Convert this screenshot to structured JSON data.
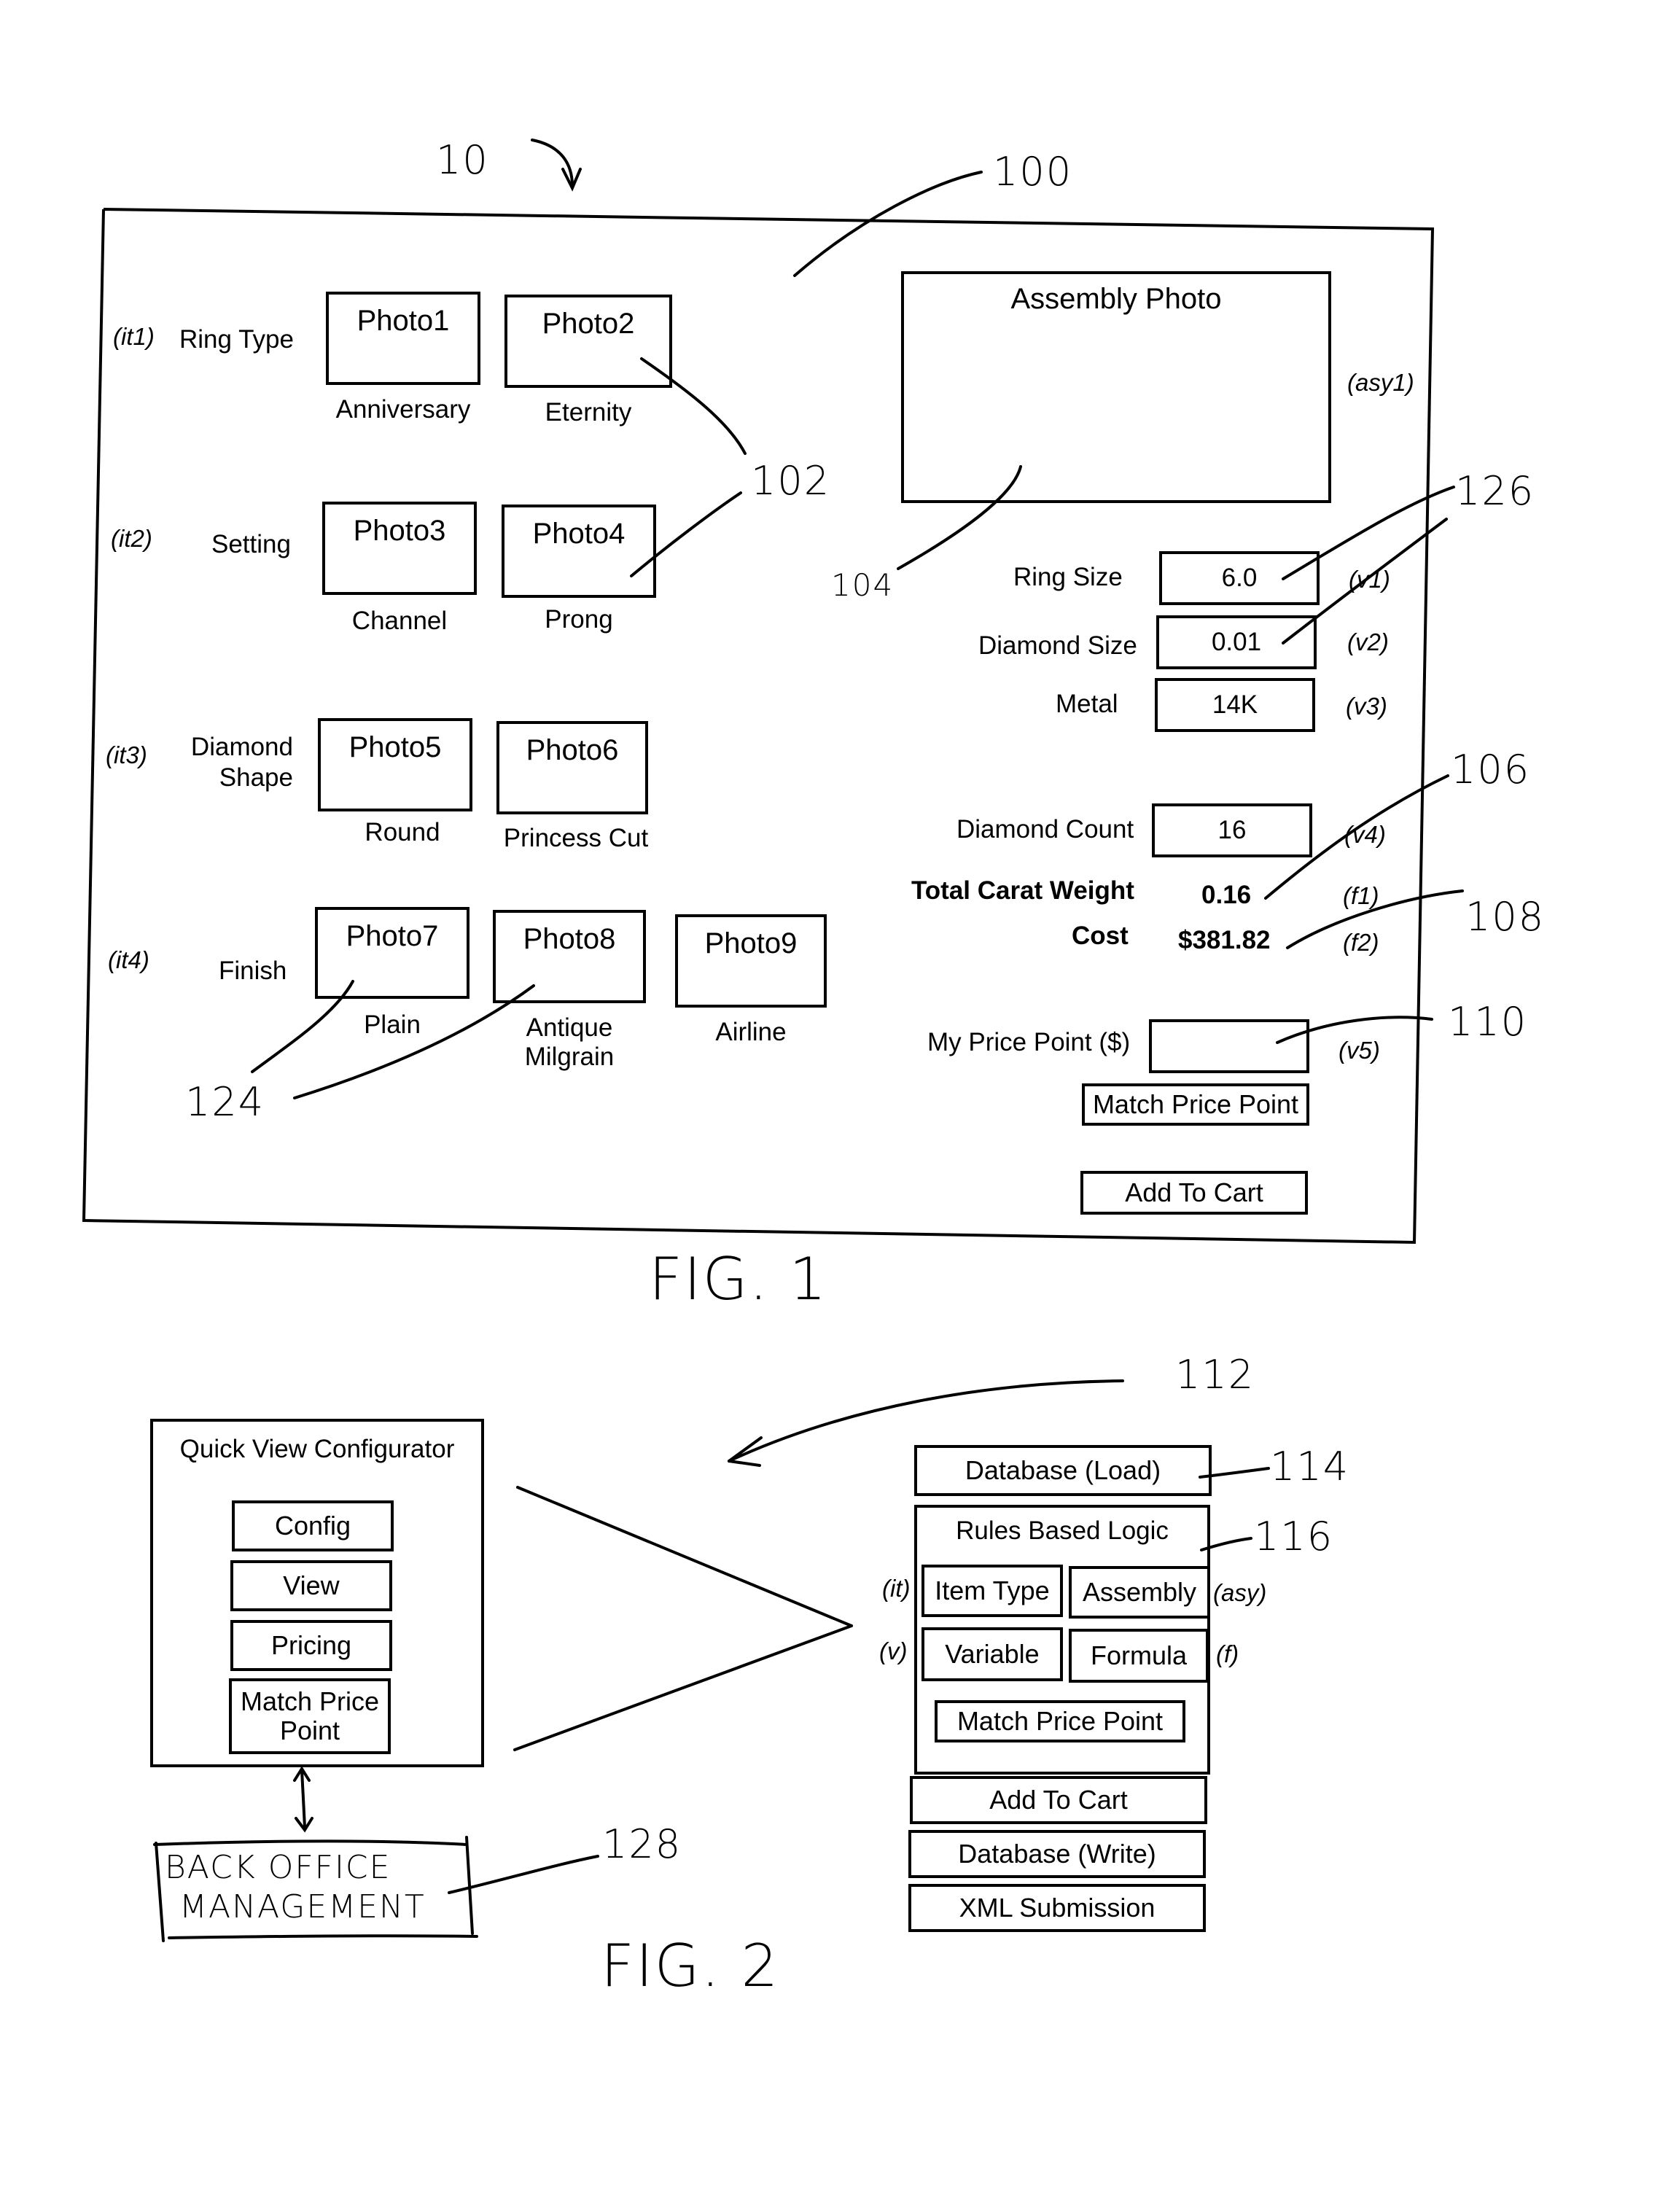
{
  "fig1": {
    "caption": "FIG. 1",
    "ref_labels": {
      "r10": "10",
      "r100": "100",
      "r102": "102",
      "r104": "104",
      "r126": "126",
      "r106": "106",
      "r108": "108",
      "r110": "110",
      "r124": "124"
    },
    "rows": [
      {
        "code": "(it1)",
        "label": "Ring Type",
        "options": [
          {
            "photo": "Photo1",
            "caption": "Anniversary"
          },
          {
            "photo": "Photo2",
            "caption": "Eternity"
          }
        ]
      },
      {
        "code": "(it2)",
        "label": "Setting",
        "options": [
          {
            "photo": "Photo3",
            "caption": "Channel"
          },
          {
            "photo": "Photo4",
            "caption": "Prong"
          }
        ]
      },
      {
        "code": "(it3)",
        "label": "Diamond Shape",
        "label_line1": "Diamond",
        "label_line2": "Shape",
        "options": [
          {
            "photo": "Photo5",
            "caption": "Round"
          },
          {
            "photo": "Photo6",
            "caption": "Princess Cut"
          }
        ]
      },
      {
        "code": "(it4)",
        "label": "Finish",
        "options": [
          {
            "photo": "Photo7",
            "caption": "Plain"
          },
          {
            "photo": "Photo8",
            "caption": "Antique Milgrain",
            "caption_line1": "Antique",
            "caption_line2": "Milgrain"
          },
          {
            "photo": "Photo9",
            "caption": "Airline"
          }
        ]
      }
    ],
    "assembly": {
      "title": "Assembly Photo",
      "code": "(asy1)"
    },
    "variables": [
      {
        "label": "Ring Size",
        "value": "6.0",
        "code": "(v1)"
      },
      {
        "label": "Diamond Size",
        "value": "0.01",
        "code": "(v2)"
      },
      {
        "label": "Metal",
        "value": "14K",
        "code": "(v3)"
      },
      {
        "label": "Diamond Count",
        "value": "16",
        "code": "(v4)"
      }
    ],
    "formulas": [
      {
        "label": "Total Carat Weight",
        "value": "0.16",
        "code": "(f1)"
      },
      {
        "label": "Cost",
        "value": "$381.82",
        "code": "(f2)"
      }
    ],
    "price_point": {
      "label": "My Price Point ($)",
      "value": "",
      "code": "(v5)"
    },
    "buttons": {
      "match": "Match Price Point",
      "add_to_cart": "Add To Cart"
    }
  },
  "fig2": {
    "caption": "FIG. 2",
    "ref_labels": {
      "r112": "112",
      "r114": "114",
      "r116": "116",
      "r128": "128"
    },
    "configurator": {
      "title": "Quick View Configurator",
      "items": [
        "Config",
        "View",
        "Pricing"
      ],
      "match_line1": "Match Price",
      "match_line2": "Point"
    },
    "back_office": {
      "line1": "BACK OFFICE",
      "line2": "MANAGEMENT"
    },
    "stack": {
      "db_load": "Database (Load)",
      "rules_title": "Rules Based Logic",
      "item_type": "Item Type",
      "item_type_code": "(it)",
      "assembly": "Assembly",
      "assembly_code": "(asy)",
      "variable": "Variable",
      "variable_code": "(v)",
      "formula": "Formula",
      "formula_code": "(f)",
      "match": "Match Price Point",
      "add_to_cart": "Add To Cart",
      "db_write": "Database (Write)",
      "xml": "XML Submission"
    }
  }
}
